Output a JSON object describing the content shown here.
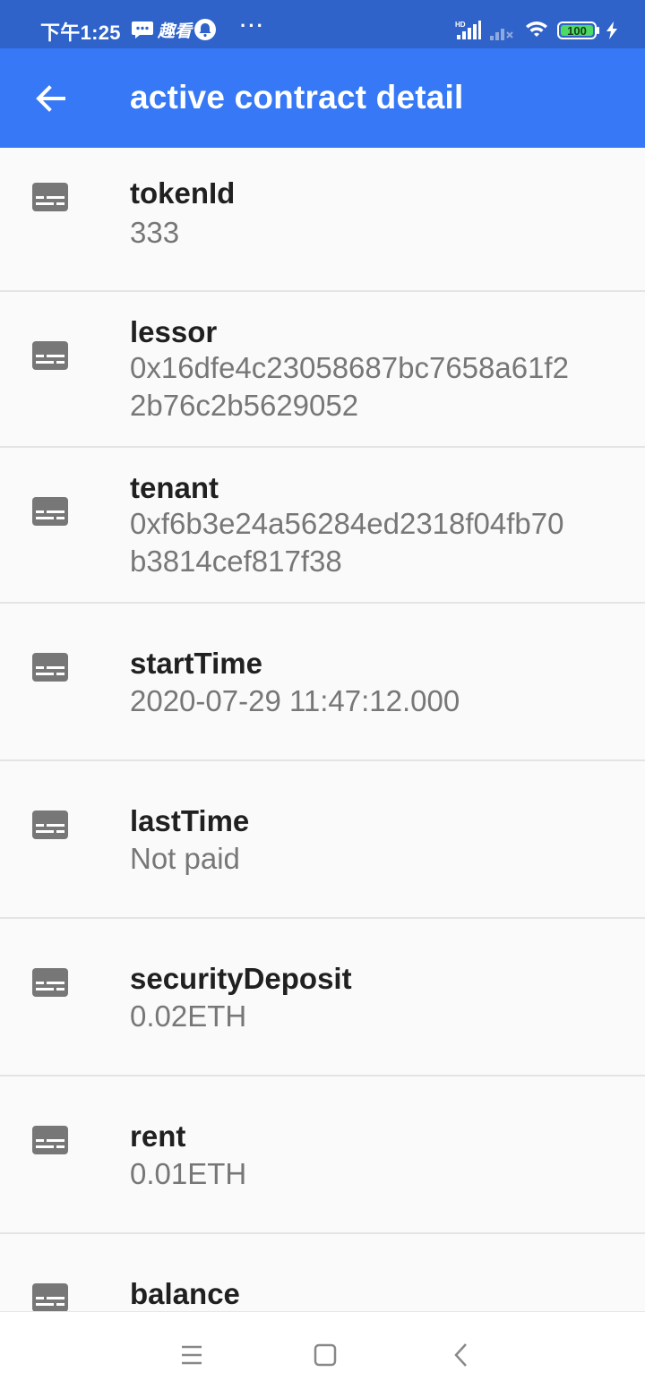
{
  "status_bar": {
    "time": "下午1:25",
    "app_label": "趣看",
    "more": "···",
    "battery": "100",
    "icons": [
      "message-icon",
      "notification-bell-icon",
      "hd-signal-icon",
      "signal-icon",
      "wifi-icon",
      "battery-icon",
      "charging-icon"
    ]
  },
  "app_bar": {
    "title": "active contract detail",
    "back_icon": "arrow-left-icon"
  },
  "items": [
    {
      "label": "tokenId",
      "value": "333",
      "icon": "subtitles-icon"
    },
    {
      "label": "lessor",
      "value_line1": "0x16dfe4c23058687bc7658a61f2",
      "value_line2": "2b76c2b5629052",
      "icon": "subtitles-icon"
    },
    {
      "label": "tenant",
      "value_line1": "0xf6b3e24a56284ed2318f04fb70",
      "value_line2": "b3814cef817f38",
      "icon": "subtitles-icon"
    },
    {
      "label": "startTime",
      "value": "2020-07-29 11:47:12.000",
      "icon": "subtitles-icon"
    },
    {
      "label": "lastTime",
      "value": "Not paid",
      "icon": "subtitles-icon"
    },
    {
      "label": "securityDeposit",
      "value": "0.02ETH",
      "icon": "subtitles-icon"
    },
    {
      "label": "rent",
      "value": "0.01ETH",
      "icon": "subtitles-icon"
    },
    {
      "label": "balance",
      "icon": "subtitles-icon"
    }
  ],
  "nav_bar": {
    "buttons": [
      "menu-icon",
      "home-square-icon",
      "back-chevron-icon"
    ]
  },
  "colors": {
    "status_bar": "#2f63c9",
    "app_bar": "#3678f5",
    "background": "#fafafa",
    "label": "#202020",
    "value": "#777777",
    "icon": "#777777"
  }
}
